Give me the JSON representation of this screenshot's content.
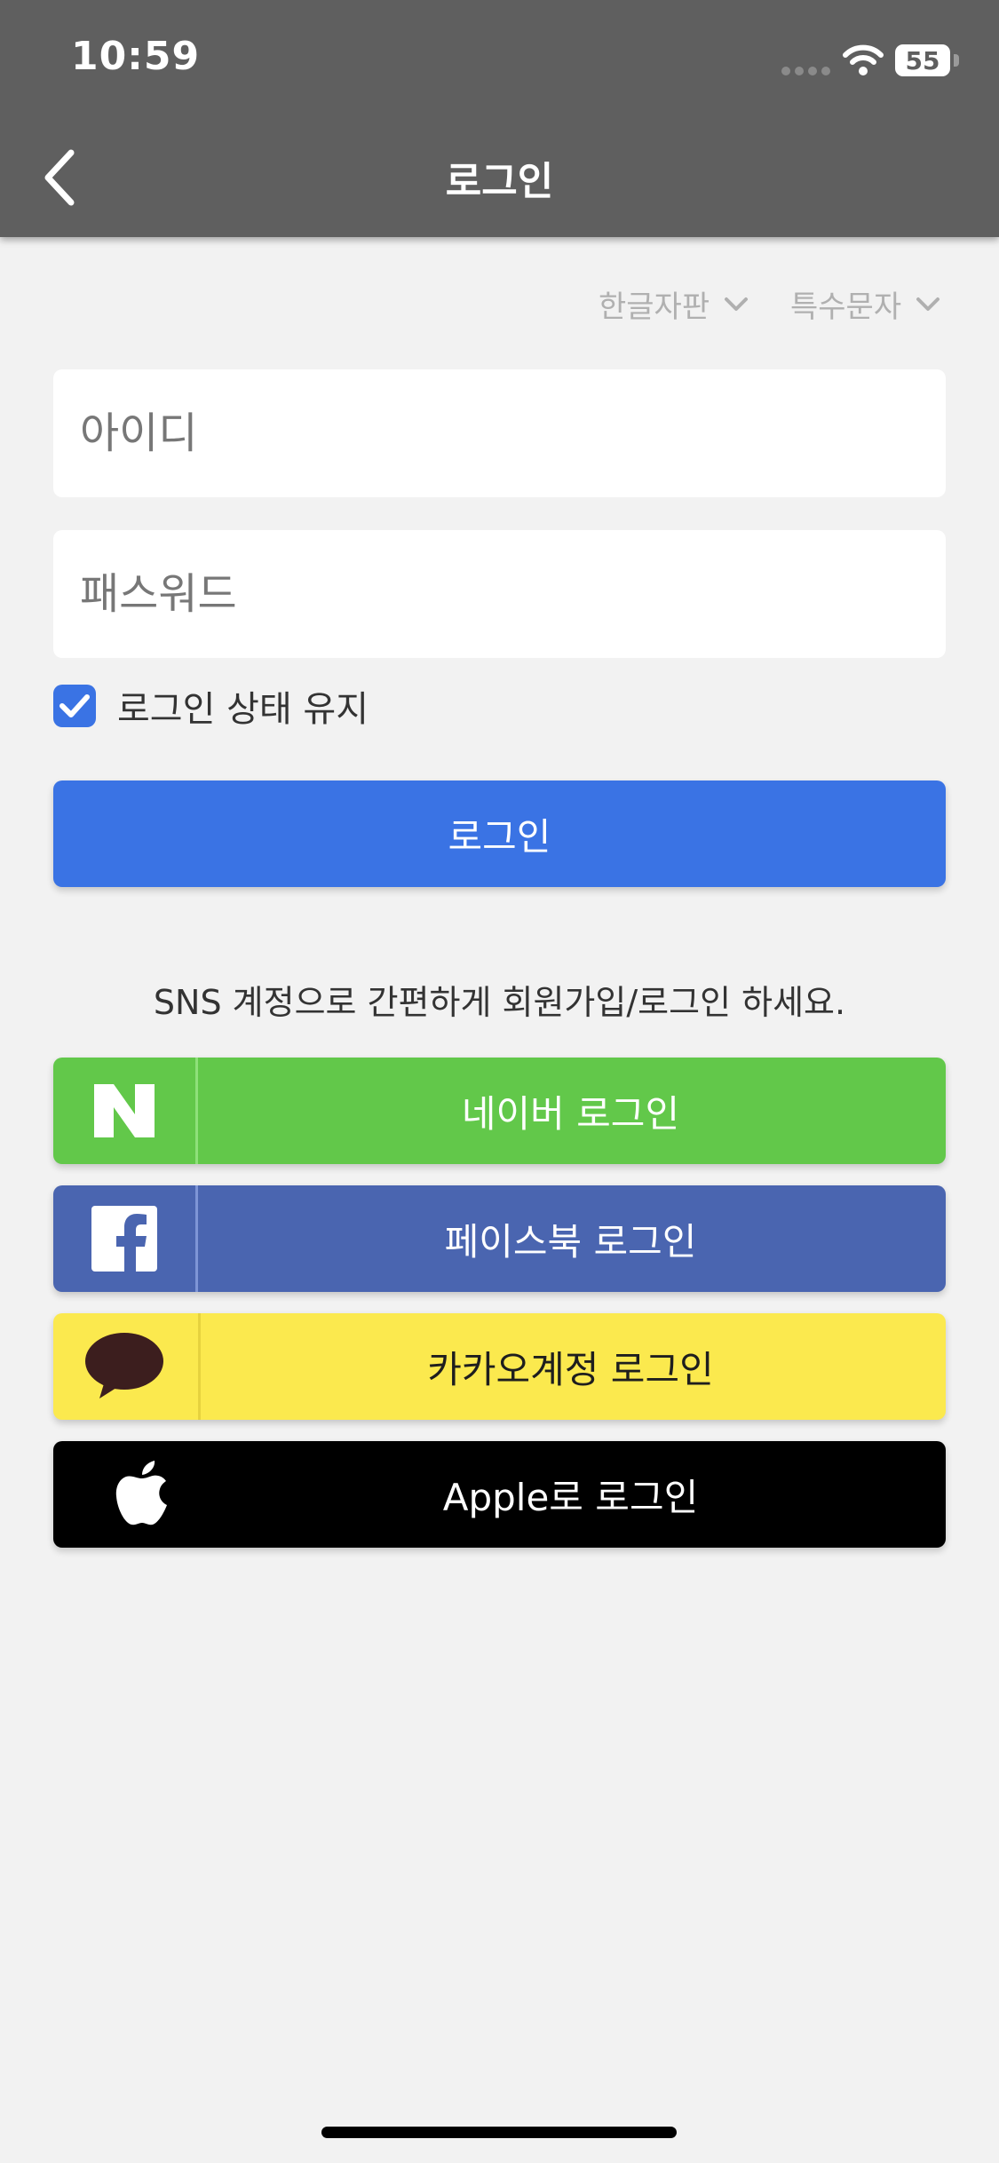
{
  "status_bar": {
    "time": "10:59",
    "battery": "55"
  },
  "nav": {
    "title": "로그인"
  },
  "keyboard_options": {
    "hangul": "한글자판",
    "special": "특수문자"
  },
  "form": {
    "id_placeholder": "아이디",
    "password_placeholder": "패스워드",
    "keep_login_label": "로그인 상태 유지",
    "keep_login_checked": true,
    "login_button": "로그인"
  },
  "sns": {
    "guide": "SNS 계정으로 간편하게 회원가입/로그인 하세요.",
    "naver": "네이버 로그인",
    "facebook": "페이스북 로그인",
    "kakao": "카카오계정 로그인",
    "apple": "Apple로 로그인"
  },
  "colors": {
    "header": "#5f5f5f",
    "primary": "#3a73e4",
    "naver": "#62c84a",
    "facebook": "#4a65b0",
    "kakao": "#fbe94e",
    "apple": "#000000"
  },
  "icons": [
    "back-chevron-icon",
    "chevron-down-icon",
    "check-icon",
    "naver-icon",
    "facebook-icon",
    "kakao-icon",
    "apple-icon",
    "wifi-icon",
    "battery-icon"
  ]
}
